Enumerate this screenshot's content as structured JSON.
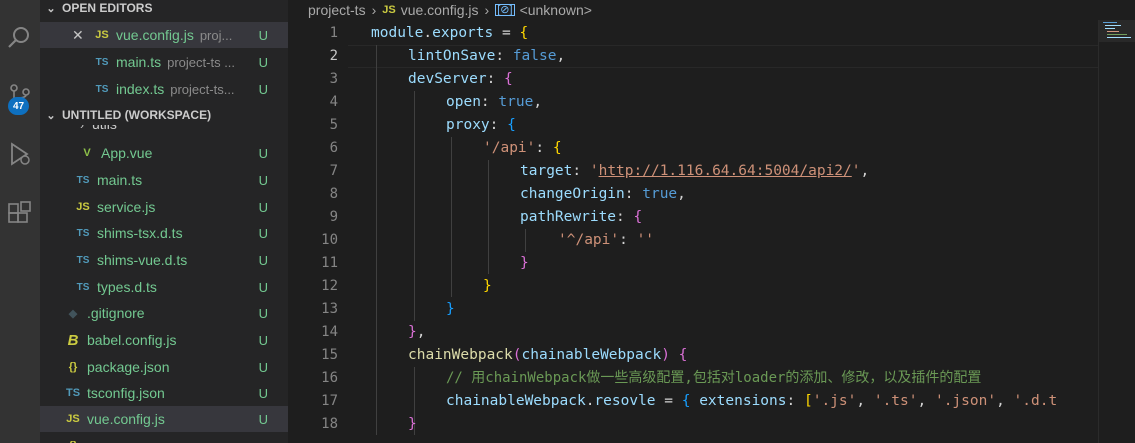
{
  "activity_bar": {
    "icons": [
      "search-icon",
      "source-control-icon",
      "run-debug-icon",
      "extensions-icon"
    ],
    "source_control_badge": "47"
  },
  "sidebar": {
    "open_editors": {
      "title": "OPEN EDITORS",
      "items": [
        {
          "icon": "JS",
          "name": "vue.config.js",
          "desc": "proj...",
          "status": "U"
        },
        {
          "icon": "TS",
          "name": "main.ts",
          "desc": "project-ts ...",
          "status": "U"
        },
        {
          "icon": "TS",
          "name": "index.ts",
          "desc": "project-ts...",
          "status": "U"
        }
      ]
    },
    "workspace": {
      "title": "UNTITLED (WORKSPACE)",
      "partial_item": "utils",
      "items": [
        {
          "icon": "V",
          "name": "App.vue",
          "status": "U"
        },
        {
          "icon": "TS",
          "name": "main.ts",
          "status": "U"
        },
        {
          "icon": "JS",
          "name": "service.js",
          "status": "U"
        },
        {
          "icon": "TS",
          "name": "shims-tsx.d.ts",
          "status": "U"
        },
        {
          "icon": "TS",
          "name": "shims-vue.d.ts",
          "status": "U"
        },
        {
          "icon": "TS",
          "name": "types.d.ts",
          "status": "U"
        },
        {
          "icon": "◆",
          "name": ".gitignore",
          "status": "U"
        },
        {
          "icon": "B",
          "name": "babel.config.js",
          "status": "U"
        },
        {
          "icon": "{}",
          "name": "package.json",
          "status": "U"
        },
        {
          "icon": "TS",
          "name": "tsconfig.json",
          "status": "U"
        },
        {
          "icon": "JS",
          "name": "vue.config.js",
          "status": "U"
        }
      ]
    }
  },
  "breadcrumb": {
    "folder": "project-ts",
    "file_icon": "JS",
    "file": "vue.config.js",
    "symbol": "<unknown>"
  },
  "editor": {
    "active_line": 2,
    "line_numbers": [
      "1",
      "2",
      "3",
      "4",
      "5",
      "6",
      "7",
      "8",
      "9",
      "10",
      "11",
      "12",
      "13",
      "14",
      "15",
      "16",
      "17",
      "18"
    ],
    "lines": {
      "l1a": "module",
      "l1b": ".",
      "l1c": "exports",
      "l1d": " = ",
      "l1e": "{",
      "l2a": "lintOnSave",
      "l2b": ": ",
      "l2c": "false",
      "l2d": ",",
      "l3a": "devServer",
      "l3b": ": ",
      "l3c": "{",
      "l4a": "open",
      "l4b": ": ",
      "l4c": "true",
      "l4d": ",",
      "l5a": "proxy",
      "l5b": ": ",
      "l5c": "{",
      "l6a": "'/api'",
      "l6b": ": ",
      "l6c": "{",
      "l7a": "target",
      "l7b": ": ",
      "l7c": "'",
      "l7d": "http://1.116.64.64:5004/api2/",
      "l7e": "'",
      "l7f": ",",
      "l8a": "changeOrigin",
      "l8b": ": ",
      "l8c": "true",
      "l8d": ",",
      "l9a": "pathRewrite",
      "l9b": ": ",
      "l9c": "{",
      "l10a": "'^/api'",
      "l10b": ": ",
      "l10c": "''",
      "l11a": "}",
      "l12a": "}",
      "l13a": "}",
      "l14a": "}",
      "l14b": ",",
      "l15a": "chainWebpack",
      "l15b": "(",
      "l15c": "chainableWebpack",
      "l15d": ")",
      "l15e": " ",
      "l15f": "{",
      "l16a": "// 用chainWebpack做一些高级配置,包括对loader的添加、修改，以及插件的配置",
      "l17a": "chainableWebpack",
      "l17b": ".",
      "l17c": "resovle",
      "l17d": " = ",
      "l17e": "{",
      "l17f": " ",
      "l17g": "extensions",
      "l17h": ": ",
      "l17i": "[",
      "l17j": "'.js'",
      "l17k": ", ",
      "l17l": "'.ts'",
      "l17m": ", ",
      "l17n": "'.json'",
      "l17o": ", ",
      "l17p": "'.d.t",
      "l18a": "}"
    }
  }
}
